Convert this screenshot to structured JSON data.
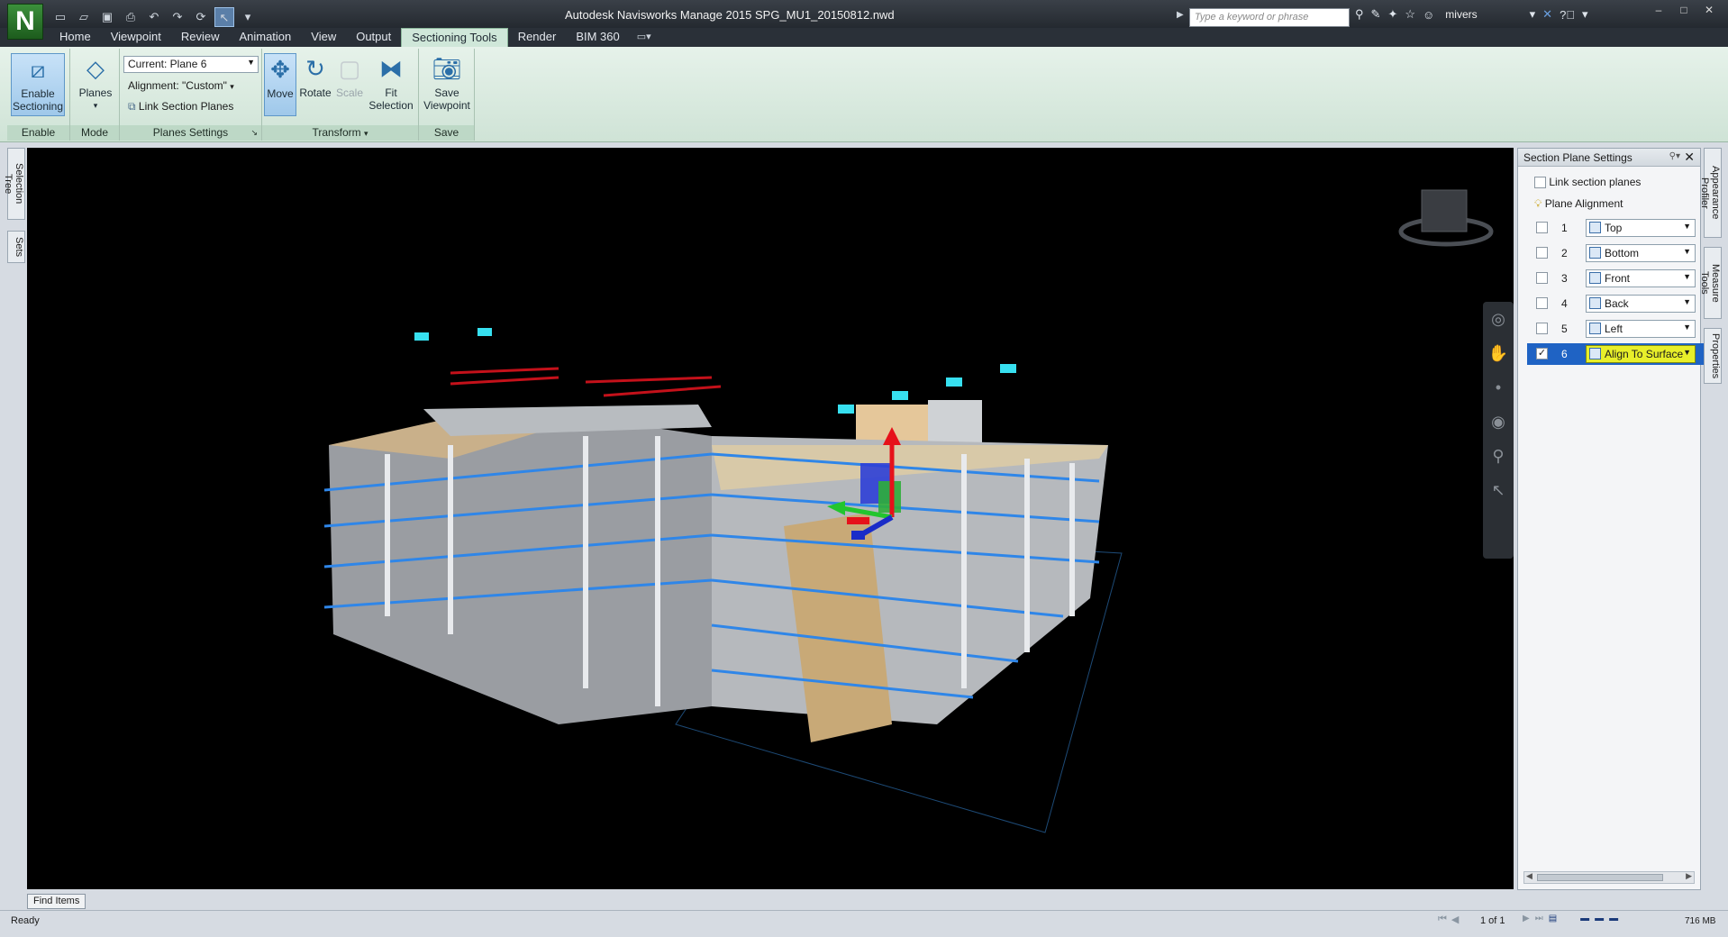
{
  "titlebar": {
    "app_logo": "N",
    "title": "Autodesk Navisworks Manage 2015    SPG_MU1_20150812.nwd",
    "search_placeholder": "Type a keyword or phrase",
    "user": "mivers"
  },
  "ribbon_tabs": [
    "Home",
    "Viewpoint",
    "Review",
    "Animation",
    "View",
    "Output",
    "Sectioning Tools",
    "Render",
    "BIM 360"
  ],
  "ribbon": {
    "enable": {
      "button": "Enable Sectioning",
      "label": "Enable"
    },
    "mode": {
      "button": "Planes",
      "label": "Mode"
    },
    "planes_settings": {
      "current_plane": "Current: Plane 6",
      "alignment": "Alignment: \"Custom\"",
      "link_planes": "Link Section Planes",
      "label": "Planes Settings"
    },
    "transform": {
      "move": "Move",
      "rotate": "Rotate",
      "scale": "Scale",
      "fit_selection": "Fit Selection",
      "label": "Transform"
    },
    "save": {
      "button": "Save Viewpoint",
      "label": "Save"
    }
  },
  "left_tabs": [
    "Selection Tree",
    "Sets"
  ],
  "right_tabs": [
    "Appearance Profiler",
    "Measure Tools",
    "Properties"
  ],
  "section_panel": {
    "title": "Section Plane Settings",
    "link_label": "Link section planes",
    "alignment_label": "Plane Alignment",
    "planes": [
      {
        "num": "1",
        "value": "Top",
        "checked": false
      },
      {
        "num": "2",
        "value": "Bottom",
        "checked": false
      },
      {
        "num": "3",
        "value": "Front",
        "checked": false
      },
      {
        "num": "4",
        "value": "Back",
        "checked": false
      },
      {
        "num": "5",
        "value": "Left",
        "checked": false
      },
      {
        "num": "6",
        "value": "Align To Surface",
        "checked": true
      }
    ]
  },
  "bottom": {
    "find_items": "Find Items",
    "status": "Ready",
    "page": "1 of 1",
    "memory": "716 MB"
  },
  "colors": {
    "ribbon_active_tab": "#cfe7d9",
    "selected_row": "#1f63c4",
    "selected_value": "#e8ef2a",
    "viewport_bg": "#000000"
  }
}
